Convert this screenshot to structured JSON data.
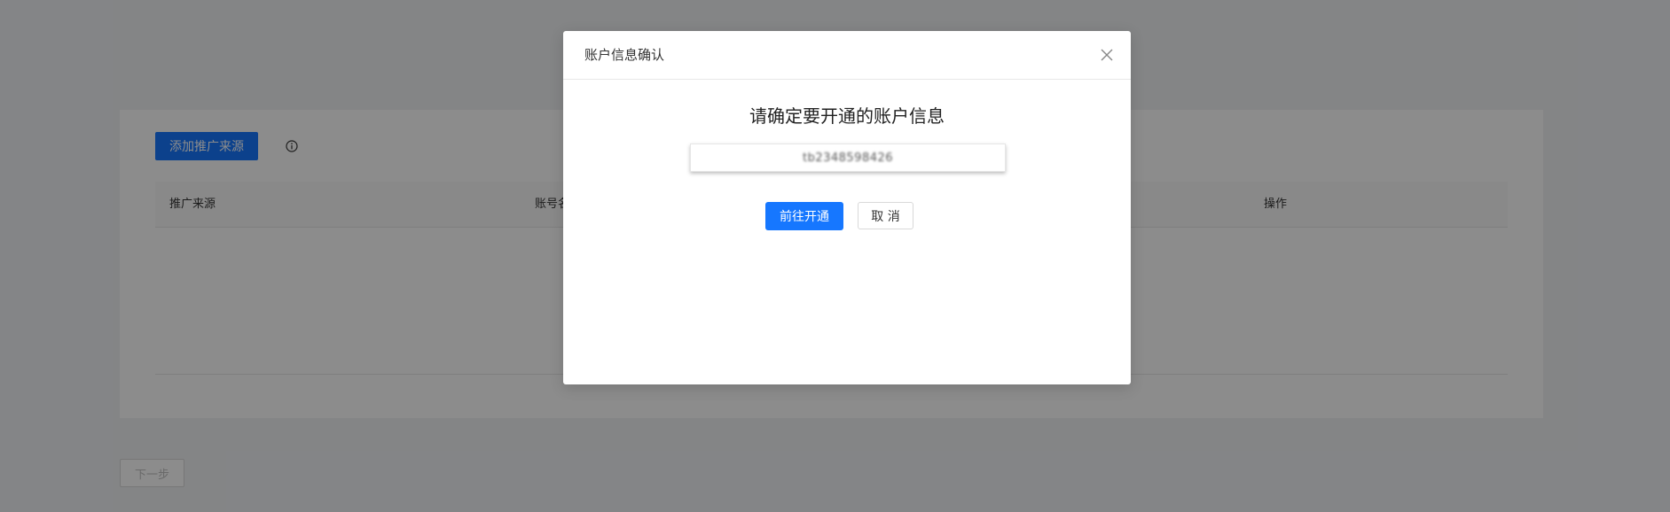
{
  "background_page": {
    "add_source_button": "添加推广来源",
    "info_icon": "info-circle-icon",
    "table": {
      "columns": [
        "推广来源",
        "账号名",
        "操作"
      ]
    },
    "next_button": "下一步"
  },
  "modal": {
    "title": "账户信息确认",
    "close_icon": "close-icon",
    "heading": "请确定要开通的账户信息",
    "account_value": "tb23485984​26",
    "primary_button": "前往开通",
    "cancel_button": "取 消"
  },
  "colors": {
    "primary": "#1677ff",
    "mask": "rgba(0,0,0,0.45)"
  }
}
